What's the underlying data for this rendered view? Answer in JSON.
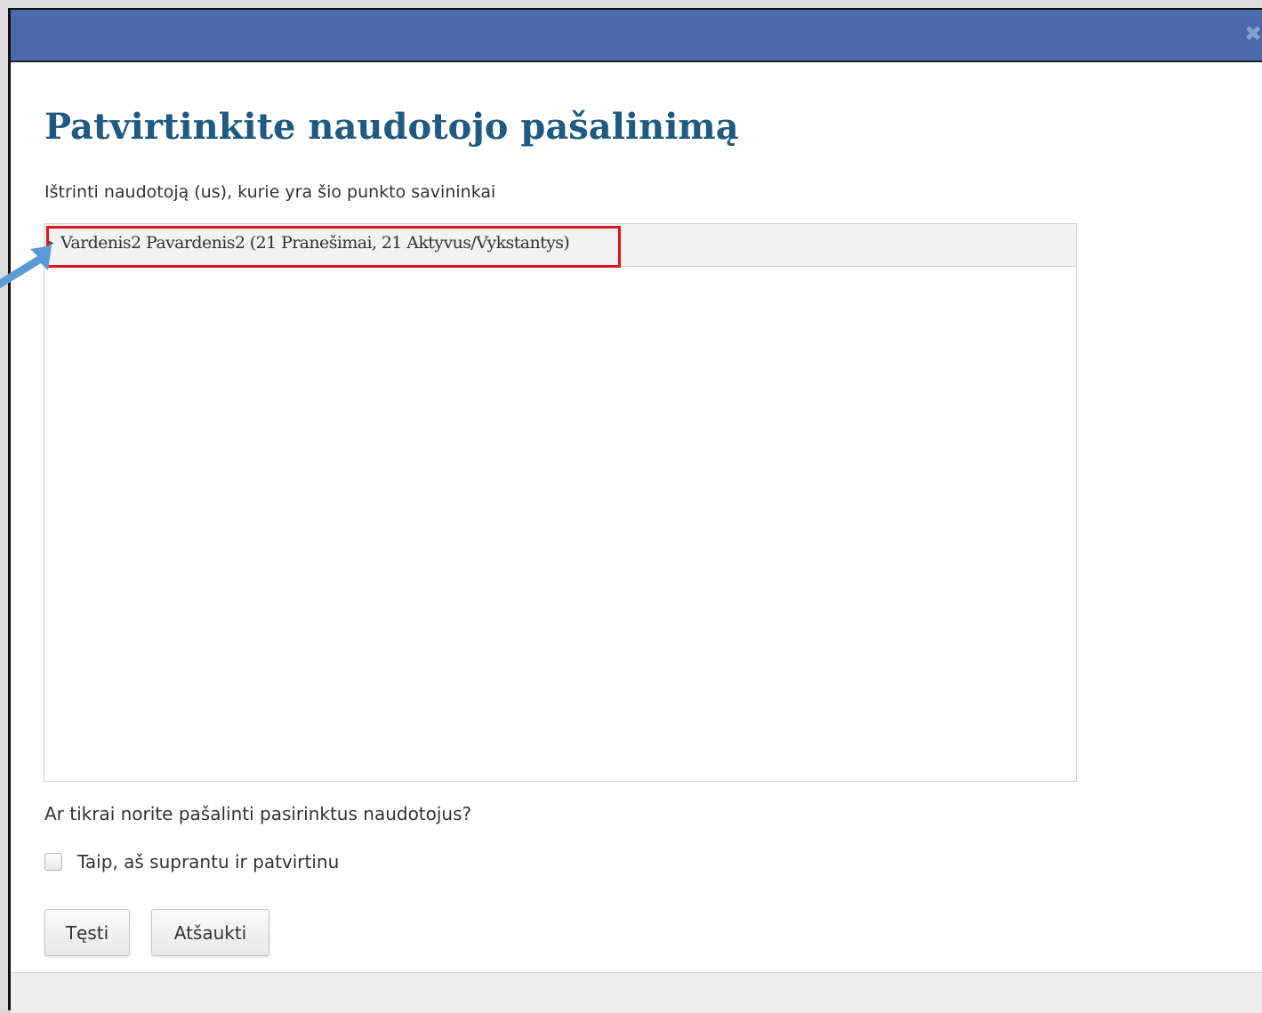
{
  "dialog": {
    "close_icon": "close-icon",
    "title": "Patvirtinkite naudotojo pašalinimą",
    "subtitle": "Ištrinti naudotoją (us), kurie yra šio punkto savininkai",
    "users": [
      {
        "label": "Vardenis2 Pavardenis2 (21 Pranešimai, 21 Aktyvus/Vykstantys)",
        "highlighted": true
      }
    ],
    "question": "Ar tikrai norite pašalinti pasirinktus naudotojus?",
    "confirm_checkbox": {
      "label": "Taip, aš suprantu ir patvirtinu",
      "checked": false
    },
    "buttons": {
      "continue": "Tęsti",
      "cancel": "Atšaukti"
    }
  },
  "colors": {
    "titlebar": "#4a6aab",
    "heading": "#1f5a82",
    "highlight": "#e0161d",
    "arrow": "#5b9bd5"
  }
}
